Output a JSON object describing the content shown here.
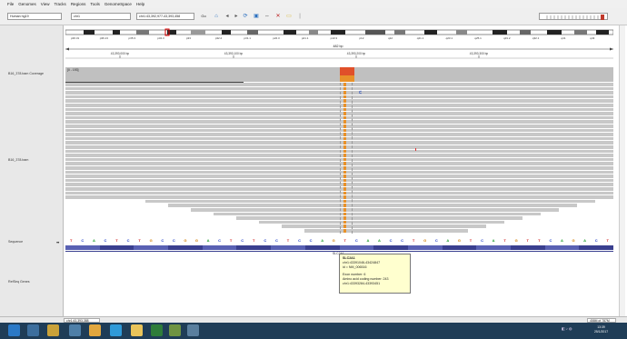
{
  "menu": [
    "File",
    "Genomes",
    "View",
    "Tracks",
    "Regions",
    "Tools",
    "GenomeSpace",
    "Help"
  ],
  "toolbar": {
    "genome": "Human hg19",
    "chromosome": "chr1",
    "locus": "chr1:43,392,977-43,393,458",
    "go": "Go"
  },
  "ideogram": {
    "bands": [
      "p36.31",
      "p36.13",
      "p35.3",
      "p34.3",
      "p33",
      "p32.2",
      "p31.1",
      "p22.3",
      "p21.1",
      "p13.3",
      "p12",
      "q12",
      "q21.1",
      "q23.1",
      "q25.1",
      "q31.2",
      "q32.1",
      "q41",
      "q43"
    ]
  },
  "ruler": {
    "span": "482 bp",
    "ticks": [
      "43,393,000 bp",
      "43,393,100 bp",
      "43,393,200 bp",
      "43,393,300 bp"
    ]
  },
  "tracks": {
    "coverage_label": "B16_378.bam Coverage",
    "coverage_range": "[0 - 193]",
    "bam_label": "B16_378.bam",
    "sequence_label": "Sequence",
    "refseq_label": "RefSeq Genes"
  },
  "sequence": {
    "bases": [
      "T",
      "C",
      "A",
      "C",
      "T",
      "C",
      "T",
      "G",
      "C",
      "C",
      "G",
      "G",
      "A",
      "C",
      "T",
      "C",
      "T",
      "C",
      "C",
      "T",
      "C",
      "C",
      "A",
      "G",
      "T",
      "C",
      "A",
      "A",
      "C",
      "C",
      "T",
      "G",
      "C",
      "A",
      "G",
      "T",
      "C",
      "A",
      "T",
      "G",
      "T",
      "T",
      "C",
      "A",
      "G",
      "A",
      "C",
      "T"
    ]
  },
  "gene_label": "SLC2A1",
  "tooltip": {
    "title": "SLC2A1",
    "lines": [
      "chr1:43391046-43424847",
      "id = NM_006516",
      "",
      "Exon number: 6",
      "Amino acid coding number: 243",
      "chr1:43393284-43393451"
    ]
  },
  "status": {
    "locus": "chr1:43,393,388",
    "memory": "458M of 787M"
  },
  "taskbar": {
    "clock_time": "13:39",
    "clock_date": "25/1/2017"
  },
  "colors": {
    "coverage_highlight": "#e0502a",
    "aa_dark": "#3a3f8f",
    "aa_mid": "#5961b3",
    "taskbar": "#1f3d57",
    "tooltip": "#ffffcf"
  }
}
